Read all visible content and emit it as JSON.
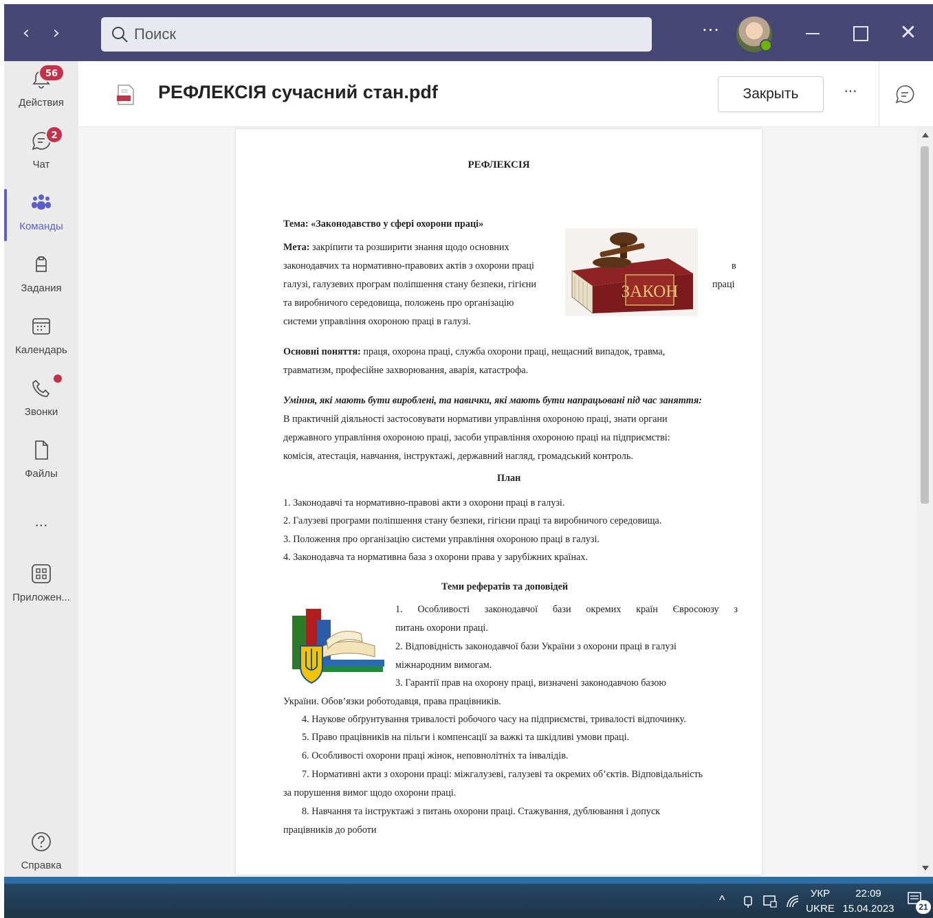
{
  "titlebar": {
    "search_placeholder": "Поиск"
  },
  "rail": {
    "items": [
      {
        "label": "Действия",
        "badge": "56"
      },
      {
        "label": "Чат",
        "badge": "2"
      },
      {
        "label": "Команды"
      },
      {
        "label": "Задания"
      },
      {
        "label": "Календарь"
      },
      {
        "label": "Звонки"
      },
      {
        "label": "Файлы"
      },
      {
        "label": "Приложен..."
      },
      {
        "label": "Справка"
      }
    ]
  },
  "file": {
    "title": "РЕФЛЕКСІЯ сучасний стан.pdf",
    "close_label": "Закрыть"
  },
  "document": {
    "title": "РЕФЛЕКСІЯ",
    "theme": "Тема: «Законодавство у сфері охорони праці»",
    "goal_label": "Мета:",
    "goal_lines": [
      "закріпити та розширити знання щодо основних",
      "законодавчих та нормативно-правових актів з охорони праці",
      "галузі, галузевих програм поліпшення стану безпеки, гігієни",
      "та виробничого середовища, положень про організацію",
      "системи управління охороною праці в галузі."
    ],
    "goal_right_fragments": [
      "в",
      "праці"
    ],
    "image_text_law": "ЗАКОН",
    "concepts_label": "Основні поняття:",
    "concepts_line1": "праця, охорона праці, служба охорони праці, нещасний випадок, травма,",
    "concepts_line2": "травматизм, професійне захворювання, аварія, катастрофа.",
    "skills_heading": "Уміння, які мають бути вироблені, та навички, які мають бути напрацьовані під час заняття:",
    "skills_lines": [
      "В практичній діяльності застосовувати нормативи управління охороною праці, знати органи",
      "державного управління охороною праці, засоби управління охороною праці на підприємстві:",
      "комісія, атестація, навчання, інструктажі, державний нагляд, громадський контроль."
    ],
    "plan_heading": "План",
    "plan_items": [
      "1. Законодавчі та нормативно-правові акти з охорони праці в галузі.",
      "2. Галузеві програми поліпшення стану безпеки, гігієни праці та виробничого середовища.",
      "3. Положення про організацію системи управління охороною праці в галузі.",
      "4. Законодавча та нормативна база з охорони права у зарубіжних країнах."
    ],
    "topics_heading": "Теми рефератів та доповідей",
    "topics_lines": [
      "1.     Особливості законодавчої бази окремих країн Євросоюзу з",
      "питань охорони праці.",
      "2.     Відповідність законодавчої бази України з охорони праці в галузі",
      "міжнародним вимогам.",
      "3.     Гарантії прав на охорону праці, визначені законодавчою базою",
      "України. Обов’язки роботодавця, права працівників.",
      "4. Наукове обґрунтування тривалості робочого часу на підприємстві, тривалості відпочинку.",
      "5. Право працівників на пільги і компенсації за важкі та шкідливі умови праці.",
      "6. Особливості охорони праці жінок, неповнолітніх та інвалідів.",
      "7. Нормативні акти з охорони праці: міжгалузеві, галузеві та окремих об’єктів. Відповідальність",
      "за порушення вимог щодо охорони праці.",
      "8. Навчання та інструктажі з питань охорони праці. Стажування, дублювання і допуск",
      "працівників до роботи"
    ]
  },
  "taskbar": {
    "lang_top": "УКР",
    "lang_bottom": "UKRE",
    "time": "22:09",
    "date": "15.04.2023",
    "notifications": "21"
  },
  "colors": {
    "titlebar": "#464775",
    "accent": "#5b5fc7",
    "badge": "#c4314b",
    "presence": "#6bb700"
  }
}
